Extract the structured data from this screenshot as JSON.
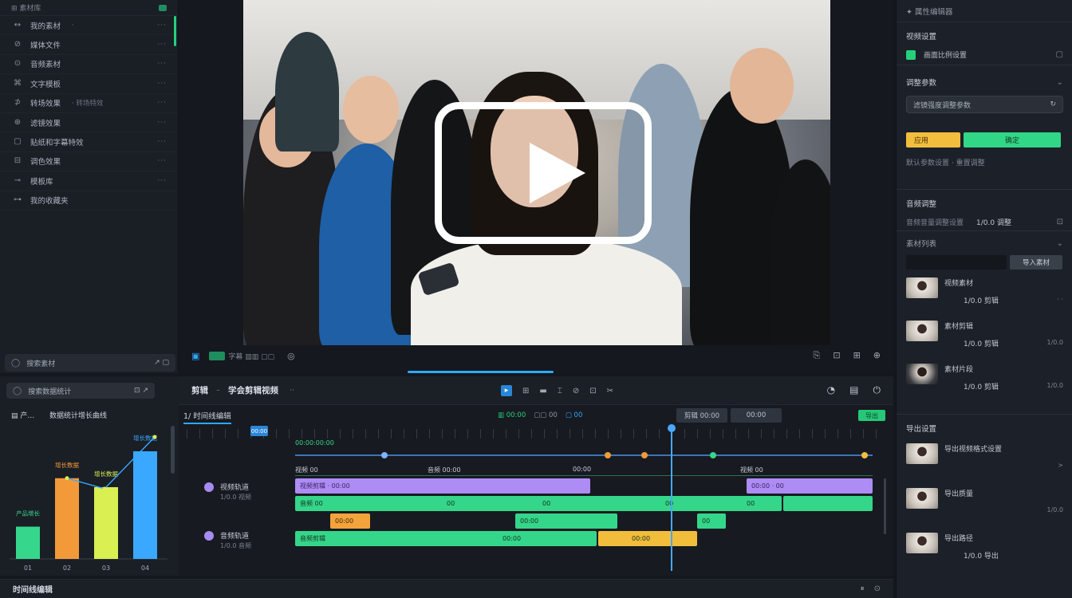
{
  "left_sidebar": {
    "top_label": "⊞ 素材库",
    "items": [
      {
        "icon": "↔",
        "label": "我的素材",
        "sub": "·",
        "more": "···"
      },
      {
        "icon": "⊘",
        "label": "媒体文件",
        "sub": "",
        "more": "···"
      },
      {
        "icon": "⊙",
        "label": "音频素材",
        "sub": "",
        "more": "···"
      },
      {
        "icon": "⌘",
        "label": "文字模板",
        "sub": "",
        "more": "···"
      },
      {
        "icon": "⊅",
        "label": "转场效果",
        "sub": "· 转场特效",
        "more": "···"
      },
      {
        "icon": "⊕",
        "label": "滤镜效果",
        "sub": "",
        "more": "···"
      },
      {
        "icon": "▢",
        "label": "贴纸和字幕特效",
        "sub": "",
        "more": "···"
      },
      {
        "icon": "⊟",
        "label": "调色效果",
        "sub": "",
        "more": "···"
      },
      {
        "icon": "⊸",
        "label": "模板库",
        "sub": "",
        "more": "···"
      },
      {
        "icon": "⊶",
        "label": "我的收藏夹",
        "sub": "",
        "more": ""
      }
    ],
    "search_label": "搜索素材",
    "search_right": "↗ ▢"
  },
  "preview": {
    "toolbar_left_text": "字幕 ▥▥ ▢▢",
    "toolbar_icons_right": [
      "⎘",
      "⊡",
      "⊞",
      "⊕"
    ]
  },
  "right_panel": {
    "header": "✦ 属性编辑器",
    "sec1_title": "视频设置",
    "sec1_row": "画面比例设置",
    "sec2_title": "调整参数",
    "sec2_input": "滤镜强度调整参数",
    "sec2_btn_yellow": "应用",
    "sec2_btn_green": "确定",
    "sec2_row": "默认参数设置 · 重置调整",
    "sec3_title": "音频调整",
    "sec3_row": "音频音量调整设置",
    "sec3_value": "1/0.0 调整",
    "sec4_title": "素材列表",
    "sec4_btn": "导入素材",
    "clips": [
      {
        "t1": "视频素材",
        "t2": "1/0.0 剪辑",
        "rt": "· ·"
      },
      {
        "t1": "素材剪辑",
        "t2": "1/0.0 剪辑",
        "rt": "1/0.0"
      },
      {
        "t1": "素材片段",
        "t2": "1/0.0 剪辑",
        "rt": "1/0.0"
      }
    ],
    "sec5_title": "导出设置",
    "exports": [
      {
        "t1": "导出视频格式设置",
        "t2": "",
        "rt": ">"
      },
      {
        "t1": "导出质量",
        "t2": "",
        "rt": "1/0.0"
      },
      {
        "t1": "导出路径",
        "t2": "1/0.0 导出",
        "rt": ""
      }
    ]
  },
  "timeline_header": {
    "project": "剪辑",
    "sep": "–",
    "subtitle": "学会剪辑视频",
    "status": "·· ",
    "tools": [
      "▸",
      "⊞",
      "▬",
      "⌶",
      "⊘",
      "⊡",
      "✂"
    ],
    "right_icons": [
      "◔",
      "▤",
      "⏻"
    ]
  },
  "chart_panel": {
    "search_label": "搜索数据统计",
    "search_right": "⊡  ↗",
    "legend_left": "▤ 产…",
    "legend_right": "数据统计增长曲线"
  },
  "chart_data": {
    "type": "bar",
    "categories": [
      "01",
      "02",
      "03",
      "04"
    ],
    "values": [
      18,
      45,
      40,
      60
    ],
    "ylim": [
      0,
      80
    ],
    "title": "",
    "xlabel": "",
    "ylabel": "",
    "bar_labels": [
      "产品增长",
      "增长数据",
      "增长数据",
      "增长数据"
    ],
    "colors": [
      "#36d68c",
      "#f29a3a",
      "#d9ef52",
      "#3aa8ff"
    ],
    "line_color": "#3aa8ff"
  },
  "timeline": {
    "tab": "1/ 时间线编辑",
    "ruler_marker": "00:00",
    "ruler_label": "00:00:00:00",
    "controls": [
      "▥ 00:00",
      "▢▢ 00",
      "▢ 00"
    ],
    "btn_a": "剪辑 00:00",
    "btn_b": "00:00",
    "btn_green": "导出",
    "track1": {
      "name": "视频轨道",
      "sub": "1/0.0 视频"
    },
    "track2": {
      "name": "音频轨道",
      "sub": "1/0.0 音频"
    },
    "row_labels": [
      "视频 00",
      "音频 00:00",
      "00:00",
      "视频 00"
    ],
    "clip_labels": {
      "p1": "视频剪辑 · 00:00",
      "p2": "00:00 · 00",
      "g1": "音频 00",
      "g1m": "00",
      "g1b": "00",
      "g1c": "00",
      "g1d": "00",
      "o1": "00:00",
      "g2": "00:00",
      "g3": "00",
      "g4": "音频剪辑",
      "g4m": "00:00",
      "y1": "00:00"
    }
  },
  "bottom_bar": {
    "label": "时间线编辑",
    "right": [
      "⏸",
      "⊙"
    ]
  }
}
